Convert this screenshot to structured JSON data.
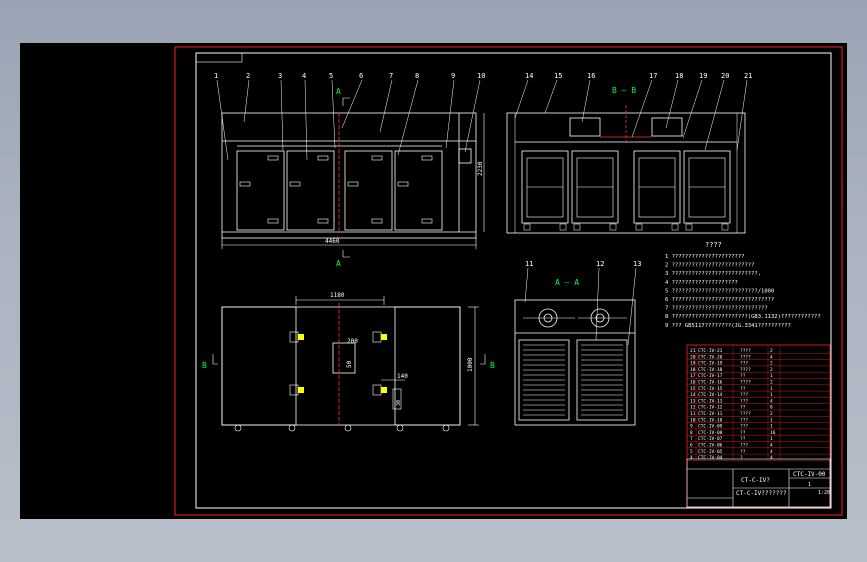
{
  "view": {
    "A": "A",
    "B": "B"
  },
  "section_titles": {
    "aa": "A — A",
    "bb": "B — B"
  },
  "front_view": {
    "callouts": [
      "1",
      "2",
      "3",
      "4",
      "5",
      "6",
      "7",
      "8",
      "9",
      "10"
    ],
    "width_dim": "4460",
    "height_dim": "2230"
  },
  "section_bb": {
    "callouts": [
      "14",
      "15",
      "16",
      "17",
      "18",
      "19",
      "20",
      "21"
    ]
  },
  "section_aa": {
    "callouts": [
      "11",
      "12",
      "13"
    ]
  },
  "plan_view": {
    "top_dim": "1180",
    "depth_dim": "1000",
    "d200": "200",
    "d50": "50",
    "d140": "140",
    "d30": "30"
  },
  "notes": {
    "title": "????",
    "lines": [
      "1  ??????????????????????",
      "2  ?????????????????????????",
      "3  ??????????????????????????,",
      "4  ????????????????????",
      "5  ??????????????????????????/1000",
      "6  ???????????????????????????????",
      "7  ?????????????????????????????",
      "8  ???????????????????????(GB3.1132)????????????",
      "9  ??? GB5117????????(JG.3341??????????"
    ]
  },
  "title_block": {
    "drawing_no": "CT-C-IV?",
    "code": "CTC-IV-00",
    "name": "CT-C-IV???????",
    "scale": "1:20",
    "sheet": "1",
    "parts": [
      {
        "no": "21",
        "code": "CTC-IV-21",
        "name": "????",
        "qty": "2"
      },
      {
        "no": "20",
        "code": "CTC-IV-20",
        "name": "????",
        "qty": "4"
      },
      {
        "no": "19",
        "code": "CTC-IV-19",
        "name": "???",
        "qty": "2"
      },
      {
        "no": "18",
        "code": "CTC-IV-18",
        "name": "????",
        "qty": "2"
      },
      {
        "no": "17",
        "code": "CTC-IV-17",
        "name": "??",
        "qty": "1"
      },
      {
        "no": "16",
        "code": "CTC-IV-16",
        "name": "????",
        "qty": "2"
      },
      {
        "no": "15",
        "code": "CTC-IV-15",
        "name": "??",
        "qty": "1"
      },
      {
        "no": "14",
        "code": "CTC-IV-14",
        "name": "???",
        "qty": "1"
      },
      {
        "no": "13",
        "code": "CTC-IV-13",
        "name": "???",
        "qty": "4"
      },
      {
        "no": "12",
        "code": "CTC-IV-12",
        "name": "??",
        "qty": "8"
      },
      {
        "no": "11",
        "code": "CTC-IV-11",
        "name": "????",
        "qty": "2"
      },
      {
        "no": "10",
        "code": "CTC-IV-10",
        "name": "???",
        "qty": "1"
      },
      {
        "no": "9",
        "code": "CTC-IV-09",
        "name": "???",
        "qty": "1"
      },
      {
        "no": "8",
        "code": "CTC-IV-08",
        "name": "??",
        "qty": "16"
      },
      {
        "no": "7",
        "code": "CTC-IV-07",
        "name": "??",
        "qty": "1"
      },
      {
        "no": "6",
        "code": "CTC-IV-06",
        "name": "???",
        "qty": "4"
      },
      {
        "no": "5",
        "code": "CTC-IV-05",
        "name": "??",
        "qty": "4"
      },
      {
        "no": "4",
        "code": "CTC-IV-04",
        "name": "?",
        "qty": "4"
      }
    ]
  }
}
